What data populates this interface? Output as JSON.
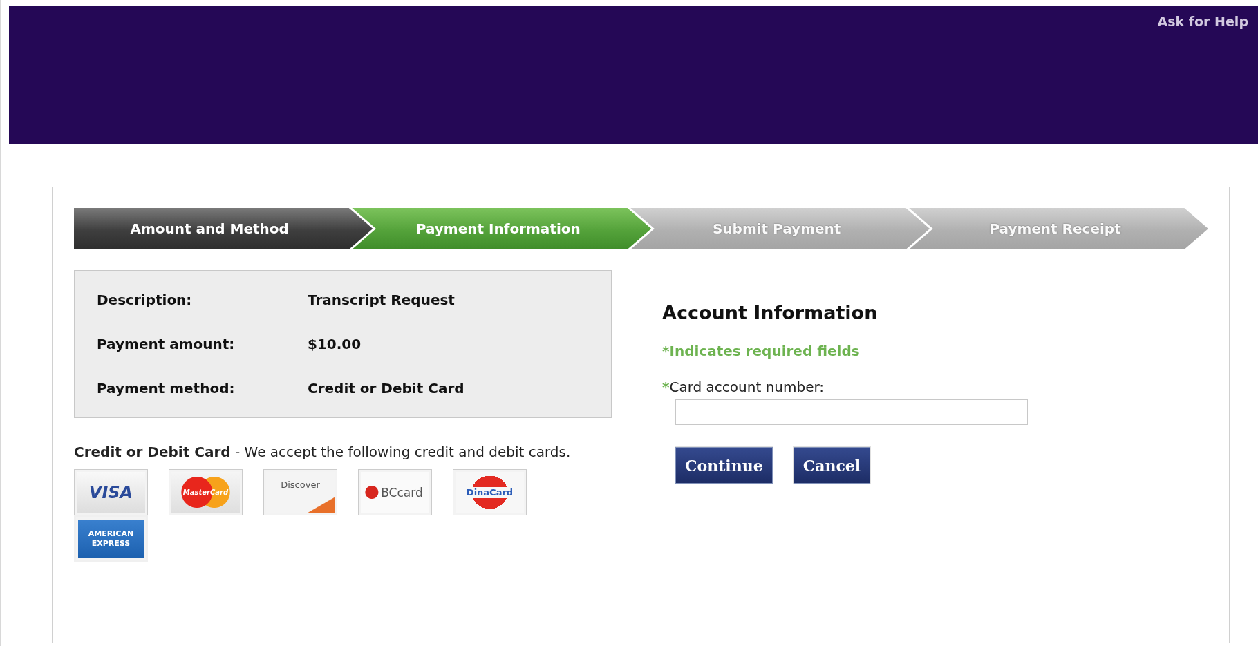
{
  "header": {
    "help_link": "Ask for Help"
  },
  "steps": [
    {
      "label": "Amount and Method",
      "completed": true,
      "selected": false
    },
    {
      "label": "Payment Information",
      "completed": false,
      "selected": true
    },
    {
      "label": "Submit Payment",
      "completed": false,
      "selected": false
    },
    {
      "label": "Payment Receipt",
      "completed": false,
      "selected": false
    }
  ],
  "summary": [
    {
      "label": "Description:",
      "value": "Transcript Request"
    },
    {
      "label": "Payment amount:",
      "value": "$10.00"
    },
    {
      "label": "Payment method:",
      "value": "Credit or Debit Card"
    }
  ],
  "cards_note": "**Credit or Debit Card** - We accept the following credit and debit cards.",
  "cards": [
    {
      "kind": "visa",
      "name": "VISA"
    },
    {
      "kind": "mastercard",
      "name": "MasterCard"
    },
    {
      "kind": "discover",
      "name": "Discover"
    },
    {
      "kind": "bccard",
      "name": "BCcard"
    },
    {
      "kind": "dinacard",
      "name": "DinaCard"
    },
    {
      "kind": "amex",
      "name": "AMERICAN EXPRESS"
    }
  ],
  "account": {
    "title": "Account Information",
    "required_note": "*Indicates required fields",
    "fields": [
      {
        "mark": "*",
        "label": "Card account number:"
      }
    ]
  },
  "buttons": [
    "Continue",
    "Cancel"
  ]
}
